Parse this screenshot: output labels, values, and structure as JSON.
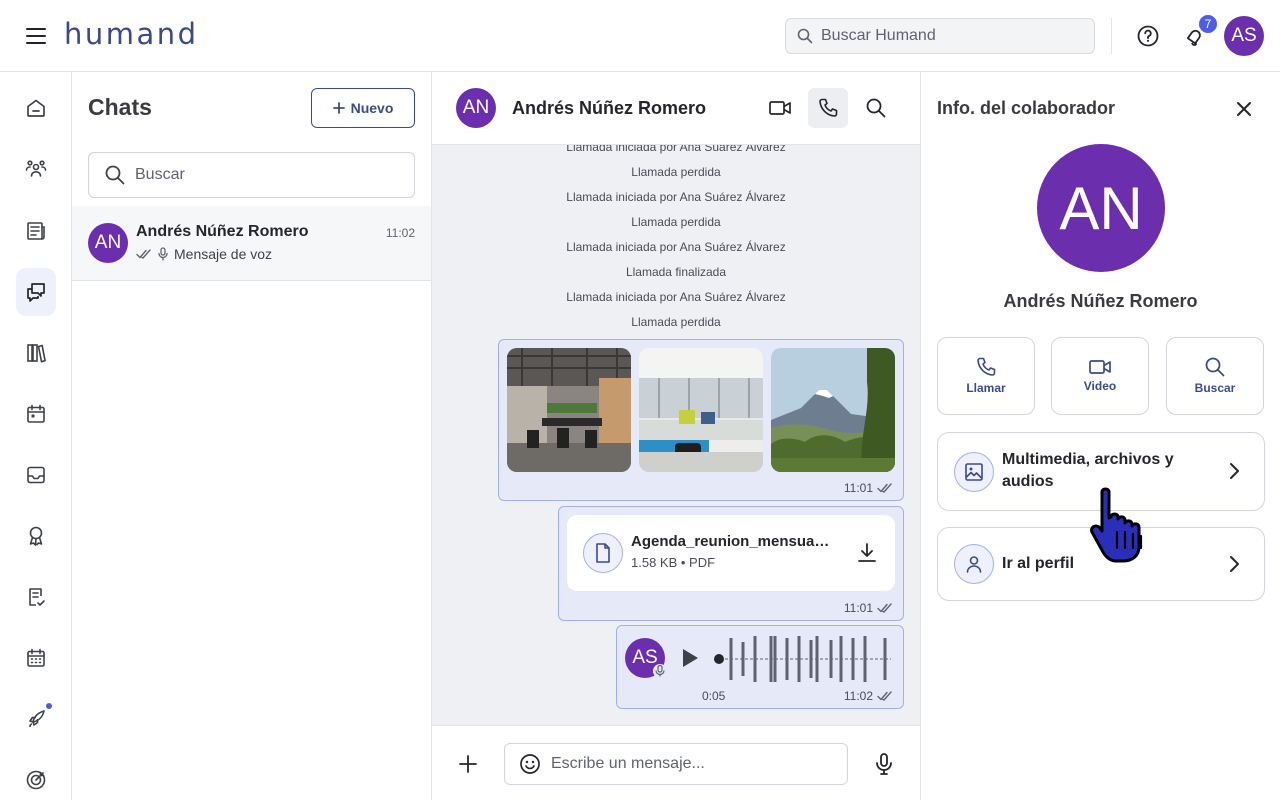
{
  "topbar": {
    "logo_text": "humand",
    "search_placeholder": "Buscar Humand",
    "notifications_count": "7",
    "user_initials": "AS"
  },
  "sidenav": {
    "items": [
      {
        "name": "home",
        "icon": "home-icon"
      },
      {
        "name": "people",
        "icon": "people-icon"
      },
      {
        "name": "news",
        "icon": "newspaper-icon"
      },
      {
        "name": "chats",
        "icon": "chat-icon",
        "active": true
      },
      {
        "name": "library",
        "icon": "library-icon"
      },
      {
        "name": "calendar",
        "icon": "calendar-icon"
      },
      {
        "name": "inbox",
        "icon": "inbox-icon"
      },
      {
        "name": "recognition",
        "icon": "badge-icon"
      },
      {
        "name": "forms",
        "icon": "checklist-icon"
      },
      {
        "name": "time-off",
        "icon": "calendar-grid-icon"
      },
      {
        "name": "onboarding",
        "icon": "rocket-icon",
        "dot": true
      },
      {
        "name": "goals",
        "icon": "target-icon"
      }
    ]
  },
  "chatlist": {
    "title": "Chats",
    "new_label": "Nuevo",
    "search_placeholder": "Buscar",
    "chats": [
      {
        "initials": "AN",
        "name": "Andrés Núñez Romero",
        "time": "11:02",
        "last_message": "Mensaje de voz"
      }
    ]
  },
  "conversation": {
    "contact_initials": "AN",
    "contact_name": "Andrés Núñez Romero",
    "system_messages": [
      "Llamada iniciada por Ana Suárez Álvarez",
      "Llamada perdida",
      "Llamada iniciada por Ana Suárez Álvarez",
      "Llamada perdida",
      "Llamada iniciada por Ana Suárez Álvarez",
      "Llamada finalizada",
      "Llamada iniciada por Ana Suárez Álvarez",
      "Llamada perdida"
    ],
    "images_message": {
      "time": "11:01"
    },
    "file_message": {
      "file_name": "Agenda_reunion_mensual.pdf",
      "file_info": "1.58 KB • PDF",
      "time": "11:01"
    },
    "audio_message": {
      "sender_initials": "AS",
      "duration": "0:05",
      "time": "11:02"
    },
    "composer_placeholder": "Escribe un mensaje..."
  },
  "info_panel": {
    "title": "Info. del colaborador",
    "initials": "AN",
    "name": "Andrés Núñez Romero",
    "actions": {
      "call": "Llamar",
      "video": "Video",
      "search": "Buscar"
    },
    "media_label": "Multimedia, archivos y audios",
    "profile_label": "Ir al perfil"
  },
  "colors": {
    "brand": "#3c4a8c",
    "avatar": "#6b2fae",
    "accent": "#4e5de2",
    "bubble": "#e6e9f8",
    "chat_bg": "#eef0f4"
  }
}
